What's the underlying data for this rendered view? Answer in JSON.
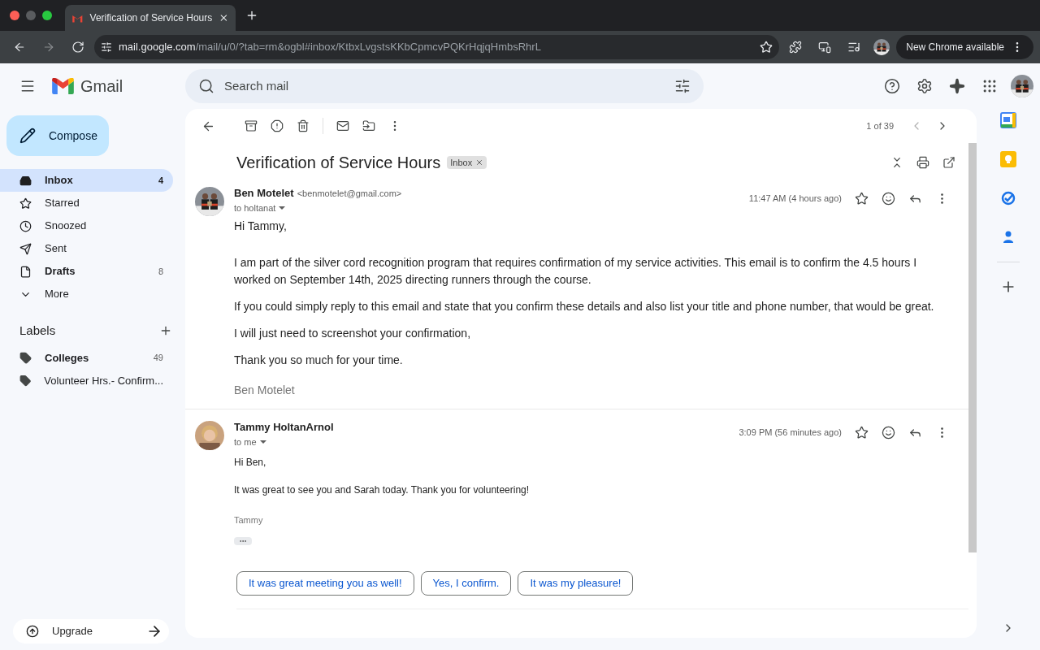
{
  "browser": {
    "tab_title": "Verification of Service Hours",
    "url_host": "mail.google.com",
    "url_path": "/mail/u/0/?tab=rm&ogbl#inbox/KtbxLvgstsKKbCpmcvPQKrHqjqHmbsRhrL",
    "update_button": "New Chrome available"
  },
  "app": {
    "logo_text": "Gmail",
    "search": {
      "placeholder": "Search mail"
    },
    "compose": "Compose"
  },
  "nav": [
    {
      "kind": "inbox",
      "label": "Inbox",
      "count": "4",
      "selected": true,
      "unread": true
    },
    {
      "kind": "starred",
      "label": "Starred",
      "selected": false,
      "unread": false
    },
    {
      "kind": "snoozed",
      "label": "Snoozed",
      "selected": false,
      "unread": false
    },
    {
      "kind": "sent",
      "label": "Sent",
      "selected": false,
      "unread": false
    },
    {
      "kind": "drafts",
      "label": "Drafts",
      "count": "8",
      "selected": false,
      "unread": true
    },
    {
      "kind": "more",
      "label": "More",
      "selected": false,
      "unread": false
    }
  ],
  "labels": {
    "heading": "Labels",
    "items": [
      {
        "name": "Colleges",
        "count": "49",
        "unread": true
      },
      {
        "name": "Volunteer Hrs.- Confirm...",
        "unread": false
      }
    ]
  },
  "upgrade": "Upgrade",
  "pager": "1 of 39",
  "thread": {
    "subject": "Verification of Service Hours",
    "tag": "Inbox",
    "messages": [
      {
        "kind": "large",
        "sender": "Ben Motelet",
        "email": "<benmotelet@gmail.com>",
        "to": "to holtanat",
        "time": "11:47 AM (4 hours ago)",
        "greeting": "Hi Tammy,",
        "paragraphs": [
          "I am part of the silver cord recognition program that requires confirmation of my service activities. This email is to confirm the 4.5 hours I worked on September 14th, 2025 directing runners through the course.",
          "If you could simply reply to this email and state that you confirm these details and also list your title and phone number, that would be great.",
          "I will just need to screenshot your confirmation,",
          "Thank you so much for your time."
        ],
        "signature": "Ben Motelet",
        "trimmed": false
      },
      {
        "kind": "small",
        "sender": "Tammy HoltanArnol",
        "to": "to me",
        "time": "3:09 PM (56 minutes ago)",
        "greeting": "Hi Ben,",
        "paragraphs": [
          "It was great to see you and Sarah today. Thank you for volunteering!"
        ],
        "signature": "Tammy",
        "trimmed": true
      }
    ]
  },
  "smart_replies": [
    "It was great meeting you as well!",
    "Yes, I confirm.",
    "It was my pleasure!"
  ]
}
